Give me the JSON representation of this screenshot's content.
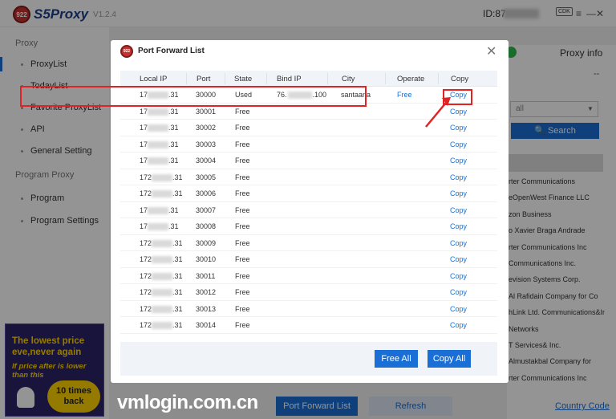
{
  "app": {
    "logo_badge": "922",
    "name": "S5Proxy",
    "version": "V1.2.4",
    "id_label": "ID:87",
    "cdk": "CDK",
    "menu_icon": "≡",
    "minimize_icon": "—",
    "close_icon": "✕"
  },
  "sidebar": {
    "section_proxy": "Proxy",
    "proxy_items": [
      "ProxyList",
      "TodayList",
      "Favorite ProxyList",
      "API",
      "General Setting"
    ],
    "section_program": "Program Proxy",
    "program_items": [
      "Program",
      "Program Settings"
    ],
    "promo": {
      "line1": "The lowest price",
      "line2": "eve,never again",
      "line3": "If price after is lower",
      "line4": "than this",
      "badge1": "10 times",
      "badge2": "back"
    }
  },
  "right_panel": {
    "proxy_info": "Proxy info",
    "dash": "--",
    "select_value": "all",
    "search_label": "Search",
    "isp_rows": [
      "rter Communications",
      "eOpenWest Finance LLC",
      "zon Business",
      "o Xavier Braga Andrade",
      "rter Communications Inc",
      "Communications Inc.",
      "evision Systems Corp.",
      "Al Rafidain Company for Co",
      "hLink Ltd. Communications&In",
      "Networks",
      "T Services& Inc.",
      "Almustakbal Company for",
      "rter Communications Inc"
    ]
  },
  "bottom": {
    "port_forward_btn": "Port Forward List",
    "refresh_btn": "Refresh",
    "country_code": "Country Code"
  },
  "watermark": "vmlogin.com.cn",
  "modal": {
    "logo_badge": "922",
    "title": "Port Forward List",
    "close": "✕",
    "columns": [
      "Local IP",
      "Port",
      "State",
      "Bind IP",
      "City",
      "Operate",
      "Copy"
    ],
    "rows": [
      {
        "ip_a": "17",
        "ip_b": ".31",
        "port": "30000",
        "state": "Used",
        "bind_a": "76.",
        "bind_b": ".100",
        "city": "santaana",
        "operate": "Free",
        "copy": "Copy"
      },
      {
        "ip_a": "17",
        "ip_b": ".31",
        "port": "30001",
        "state": "Free",
        "copy": "Copy"
      },
      {
        "ip_a": "17",
        "ip_b": ".31",
        "port": "30002",
        "state": "Free",
        "copy": "Copy"
      },
      {
        "ip_a": "17",
        "ip_b": ".31",
        "port": "30003",
        "state": "Free",
        "copy": "Copy"
      },
      {
        "ip_a": "17",
        "ip_b": ".31",
        "port": "30004",
        "state": "Free",
        "copy": "Copy"
      },
      {
        "ip_a": "172",
        "ip_b": ".31",
        "port": "30005",
        "state": "Free",
        "copy": "Copy"
      },
      {
        "ip_a": "172",
        "ip_b": ".31",
        "port": "30006",
        "state": "Free",
        "copy": "Copy"
      },
      {
        "ip_a": "17",
        "ip_b": ".31",
        "port": "30007",
        "state": "Free",
        "copy": "Copy"
      },
      {
        "ip_a": "17",
        "ip_b": ".31",
        "port": "30008",
        "state": "Free",
        "copy": "Copy"
      },
      {
        "ip_a": "172",
        "ip_b": ".31",
        "port": "30009",
        "state": "Free",
        "copy": "Copy"
      },
      {
        "ip_a": "172",
        "ip_b": ".31",
        "port": "30010",
        "state": "Free",
        "copy": "Copy"
      },
      {
        "ip_a": "172",
        "ip_b": ".31",
        "port": "30011",
        "state": "Free",
        "copy": "Copy"
      },
      {
        "ip_a": "172",
        "ip_b": ".31",
        "port": "30012",
        "state": "Free",
        "copy": "Copy"
      },
      {
        "ip_a": "172",
        "ip_b": ".31",
        "port": "30013",
        "state": "Free",
        "copy": "Copy"
      },
      {
        "ip_a": "172",
        "ip_b": ".31",
        "port": "30014",
        "state": "Free",
        "copy": "Copy"
      }
    ],
    "free_all": "Free All",
    "copy_all": "Copy All"
  },
  "colors": {
    "accent": "#1a6fd6",
    "highlight": "#e02424",
    "brand_red": "#c8312f"
  }
}
